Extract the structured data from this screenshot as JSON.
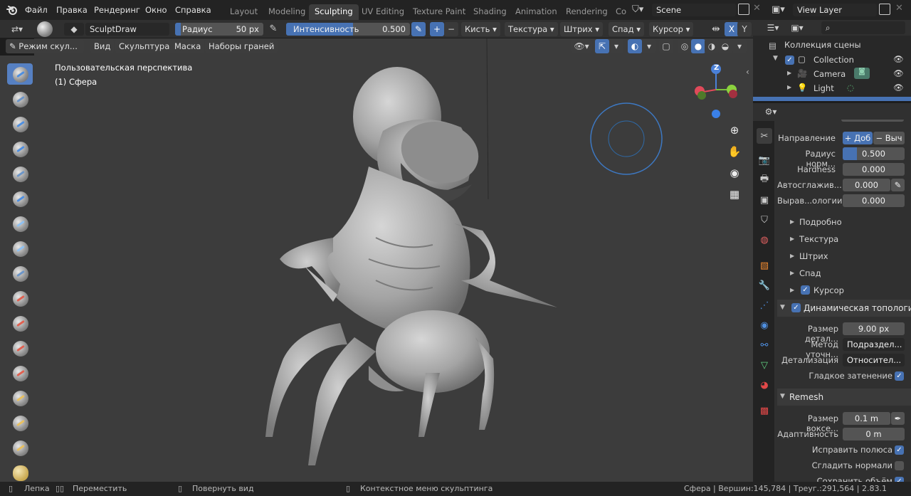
{
  "topbar": {
    "menus": [
      "Файл",
      "Правка",
      "Рендеринг",
      "Окно",
      "Справка"
    ],
    "workspaces": [
      "Layout",
      "Modeling",
      "Sculpting",
      "UV Editing",
      "Texture Paint",
      "Shading",
      "Animation",
      "Rendering",
      "Co"
    ],
    "active_workspace": "Sculpting",
    "scene": "Scene",
    "view_layer": "View Layer"
  },
  "tool_header": {
    "brush_name": "SculptDraw",
    "radius_label": "Радиус",
    "radius_value": "50 px",
    "strength_label": "Интенсивность",
    "strength_value": "0.500",
    "plus": "+",
    "minus": "−",
    "menus": [
      "Кисть",
      "Текстура",
      "Штрих",
      "Спад",
      "Курсор"
    ],
    "axis_x": "X",
    "axis_y": "Y"
  },
  "viewport_header": {
    "mode": "Режим скул...",
    "menus": [
      "Вид",
      "Скульптура",
      "Маска",
      "Наборы граней"
    ]
  },
  "viewport": {
    "perspective": "Пользовательская перспектива",
    "object": "(1) Сфера",
    "gizmo_z": "Z"
  },
  "outliner": {
    "title": "Коллекция сцены",
    "items": [
      {
        "name": "Collection"
      },
      {
        "name": "Camera"
      },
      {
        "name": "Light"
      }
    ]
  },
  "props": {
    "direction_label": "Направление",
    "direction_add": "+ Доб",
    "direction_sub": "− Выч",
    "rows": [
      {
        "label": "Радиус норм...",
        "value": "0.500"
      },
      {
        "label": "Hardness",
        "value": "0.000"
      },
      {
        "label": "Автосглажив...",
        "value": "0.000"
      },
      {
        "label": "Вырав...ологии",
        "value": "0.000"
      }
    ],
    "sections": [
      "Подробно",
      "Текстура",
      "Штрих",
      "Спад"
    ],
    "cursor_label": "Курсор",
    "dyntopo_title": "Динамическая топология",
    "dyntopo_rows": [
      {
        "label": "Размер детал...",
        "value": "9.00 px"
      },
      {
        "label": "Метод уточн...",
        "value": "Подраздел..."
      },
      {
        "label": "Детализация",
        "value": "Относител..."
      }
    ],
    "smooth_shading": "Гладкое затенение",
    "remesh_title": "Remesh",
    "voxel_label": "Размер воксе...",
    "voxel_value": "0.1 m",
    "adapt_label": "Адаптивность",
    "adapt_value": "0 m",
    "fix_poles": "Исправить полюса",
    "smooth_normals": "Сгладить нормали",
    "preserve_volume": "Сохранить объём"
  },
  "statusbar": {
    "left1": "Лепка",
    "left2": "Переместить",
    "left3": "Повернуть вид",
    "left4": "Контекстное меню скульптинга",
    "right": "Сфера | Вершин:145,784 | Треуг.:291,564 | 2.83.1"
  },
  "colors": {
    "accent": "#4772b3",
    "active_tool": "#5680c2",
    "viewport_bg": "#3c3c3c"
  }
}
